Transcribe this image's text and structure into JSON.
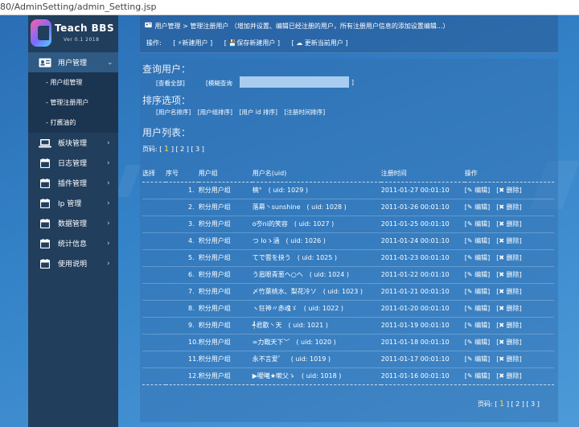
{
  "browser": {
    "url": "80/AdminSetting/admin_Setting.jsp"
  },
  "logo": {
    "title": "Teach BBS",
    "version": "Ver 0.1  2018"
  },
  "sidebar": {
    "items": [
      {
        "label": "用户管理",
        "icon": "user-card-icon",
        "active": true,
        "children": [
          "- 用户组管理",
          "- 管理注册用户",
          "- 打酱油的"
        ]
      },
      {
        "label": "板块管理",
        "icon": "laptop-icon"
      },
      {
        "label": "日志管理",
        "icon": "calendar-icon"
      },
      {
        "label": "插件管理",
        "icon": "calendar-icon"
      },
      {
        "label": "Ip 管理",
        "icon": "calendar-icon"
      },
      {
        "label": "数据管理",
        "icon": "calendar-icon"
      },
      {
        "label": "统计信息",
        "icon": "calendar-icon"
      },
      {
        "label": "使用说明",
        "icon": "calendar-icon"
      }
    ]
  },
  "topbar": {
    "breadcrumb": "用户管理 > 管理注册用户  （增加并设置、编辑已经注册的用户，所有注册用户信息的添加设置编辑...）",
    "ops_label": "操作:",
    "new_user": "[ ⚡新建用户 ]",
    "save_user": "[ 💾保存新建用户 ]",
    "refresh_user": "[ ☁ 更新当前用户 ]"
  },
  "query": {
    "title": "查询用户：",
    "view_all": "[查看全部]",
    "fuzzy": "[模糊查询",
    "fuzzy_end": "]",
    "search_value": ""
  },
  "sort": {
    "title": "排序选项：",
    "options": [
      "[用户名排序]",
      "[用户组排序]",
      "[用户 id 排序]",
      "[注册时间排序]"
    ]
  },
  "list": {
    "title": "用户列表：",
    "pager_label": "页码:",
    "pages": [
      "1",
      "2",
      "3"
    ],
    "columns": [
      "选择",
      "序号",
      "用户组",
      "用户名(uid)",
      "注册时间",
      "操作"
    ],
    "edit": "[✎ 编辑]",
    "delete": "[✖ 删除]",
    "rows": [
      {
        "no": "1.",
        "group": "积分用户组",
        "name": "楠°　( uid: 1029 )",
        "time": "2011-01-27 00:01:10"
      },
      {
        "no": "2.",
        "group": "积分用户组",
        "name": "落幕丶sunshine　( uid: 1028 )",
        "time": "2011-01-26 00:01:10"
      },
      {
        "no": "3.",
        "group": "积分用户组",
        "name": "o冭ni的笑容　( uid: 1027 )",
        "time": "2011-01-25 00:01:10"
      },
      {
        "no": "4.",
        "group": "积分用户组",
        "name": "つ Ioゝ涵　( uid: 1026 )",
        "time": "2011-01-24 00:01:10"
      },
      {
        "no": "5.",
        "group": "积分用户组",
        "name": "てで雲を抉う　( uid: 1025 )",
        "time": "2011-01-23 00:01:10"
      },
      {
        "no": "6.",
        "group": "积分用户组",
        "name": "う眉眼青葱ヘ○ヘ　( uid: 1024 )",
        "time": "2011-01-22 00:01:10"
      },
      {
        "no": "7.",
        "group": "积分用户组",
        "name": "〆竹葉桃水、梨花冷ソ　( uid: 1023 )",
        "time": "2011-01-21 00:01:10"
      },
      {
        "no": "8.",
        "group": "积分用户组",
        "name": "ヽ狂神〃赤魂ゞ　( uid: 1022 )",
        "time": "2011-01-20 00:01:10"
      },
      {
        "no": "9.",
        "group": "积分用户组",
        "name": "╃君歡丶天　( uid: 1021 )",
        "time": "2011-01-19 00:01:10"
      },
      {
        "no": "10.",
        "group": "积分用户组",
        "name": "∞力戰天下﹀　( uid: 1020 )",
        "time": "2011-01-18 00:01:10"
      },
      {
        "no": "11.",
        "group": "积分用户组",
        "name": "永不言爱゛　( uid: 1019 )",
        "time": "2011-01-17 00:01:10"
      },
      {
        "no": "12.",
        "group": "积分用户组",
        "name": "▶曖曦★嗽父ゝ　( uid: 1018 )",
        "time": "2011-01-16 00:01:10"
      }
    ],
    "footer_pager_label": "页码:"
  }
}
